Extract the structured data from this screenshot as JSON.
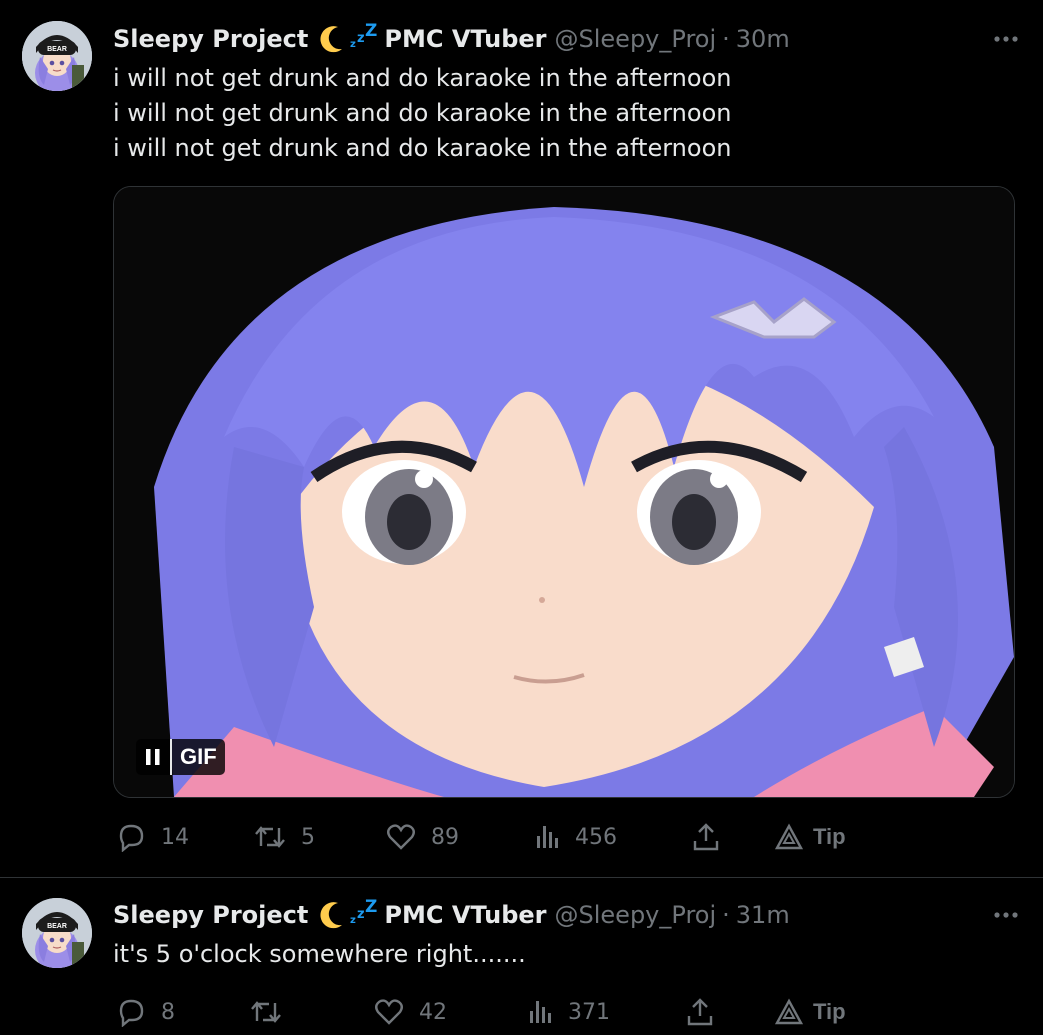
{
  "tweets": [
    {
      "author": {
        "name": "Sleepy Project",
        "tag": "PMC VTuber",
        "handle": "@Sleepy_Proj",
        "time": "30m",
        "avatar_cap_text": "BEAR",
        "emoji_moon": "crescent-moon-icon",
        "emoji_zzz": "zzz-icon"
      },
      "lines": [
        "i will not get drunk and do karaoke in the afternoon",
        "i will not get drunk and do karaoke in the afternoon",
        "i will not get drunk and do karaoke in the afternoon"
      ],
      "media": {
        "type": "gif",
        "badge_label": "GIF"
      },
      "actions": {
        "replies": "14",
        "reposts": "5",
        "likes": "89",
        "views": "456",
        "tip": "Tip"
      }
    },
    {
      "author": {
        "name": "Sleepy Project",
        "tag": "PMC VTuber",
        "handle": "@Sleepy_Proj",
        "time": "31m",
        "avatar_cap_text": "BEAR"
      },
      "lines": [
        "it's 5 o'clock somewhere right......."
      ],
      "actions": {
        "replies": "8",
        "reposts": "",
        "likes": "42",
        "views": "371",
        "tip": "Tip"
      }
    }
  ],
  "colors": {
    "background": "#000000",
    "text": "#e7e9ea",
    "muted": "#71767b",
    "zzz": "#1d9bf0",
    "moon": "#ffcc4d"
  }
}
